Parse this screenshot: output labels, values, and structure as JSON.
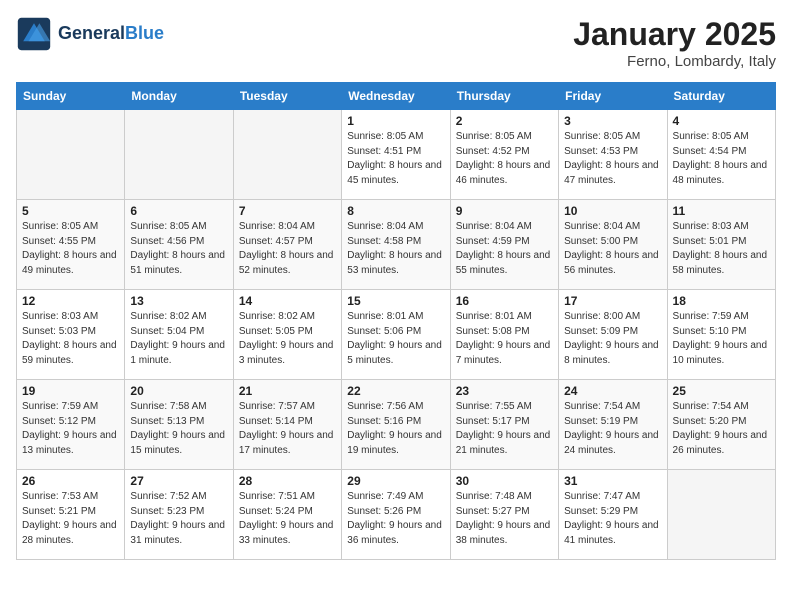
{
  "header": {
    "logo_line1": "General",
    "logo_line2": "Blue",
    "title": "January 2025",
    "subtitle": "Ferno, Lombardy, Italy"
  },
  "weekdays": [
    "Sunday",
    "Monday",
    "Tuesday",
    "Wednesday",
    "Thursday",
    "Friday",
    "Saturday"
  ],
  "weeks": [
    [
      {
        "day": "",
        "info": ""
      },
      {
        "day": "",
        "info": ""
      },
      {
        "day": "",
        "info": ""
      },
      {
        "day": "1",
        "info": "Sunrise: 8:05 AM\nSunset: 4:51 PM\nDaylight: 8 hours\nand 45 minutes."
      },
      {
        "day": "2",
        "info": "Sunrise: 8:05 AM\nSunset: 4:52 PM\nDaylight: 8 hours\nand 46 minutes."
      },
      {
        "day": "3",
        "info": "Sunrise: 8:05 AM\nSunset: 4:53 PM\nDaylight: 8 hours\nand 47 minutes."
      },
      {
        "day": "4",
        "info": "Sunrise: 8:05 AM\nSunset: 4:54 PM\nDaylight: 8 hours\nand 48 minutes."
      }
    ],
    [
      {
        "day": "5",
        "info": "Sunrise: 8:05 AM\nSunset: 4:55 PM\nDaylight: 8 hours\nand 49 minutes."
      },
      {
        "day": "6",
        "info": "Sunrise: 8:05 AM\nSunset: 4:56 PM\nDaylight: 8 hours\nand 51 minutes."
      },
      {
        "day": "7",
        "info": "Sunrise: 8:04 AM\nSunset: 4:57 PM\nDaylight: 8 hours\nand 52 minutes."
      },
      {
        "day": "8",
        "info": "Sunrise: 8:04 AM\nSunset: 4:58 PM\nDaylight: 8 hours\nand 53 minutes."
      },
      {
        "day": "9",
        "info": "Sunrise: 8:04 AM\nSunset: 4:59 PM\nDaylight: 8 hours\nand 55 minutes."
      },
      {
        "day": "10",
        "info": "Sunrise: 8:04 AM\nSunset: 5:00 PM\nDaylight: 8 hours\nand 56 minutes."
      },
      {
        "day": "11",
        "info": "Sunrise: 8:03 AM\nSunset: 5:01 PM\nDaylight: 8 hours\nand 58 minutes."
      }
    ],
    [
      {
        "day": "12",
        "info": "Sunrise: 8:03 AM\nSunset: 5:03 PM\nDaylight: 8 hours\nand 59 minutes."
      },
      {
        "day": "13",
        "info": "Sunrise: 8:02 AM\nSunset: 5:04 PM\nDaylight: 9 hours\nand 1 minute."
      },
      {
        "day": "14",
        "info": "Sunrise: 8:02 AM\nSunset: 5:05 PM\nDaylight: 9 hours\nand 3 minutes."
      },
      {
        "day": "15",
        "info": "Sunrise: 8:01 AM\nSunset: 5:06 PM\nDaylight: 9 hours\nand 5 minutes."
      },
      {
        "day": "16",
        "info": "Sunrise: 8:01 AM\nSunset: 5:08 PM\nDaylight: 9 hours\nand 7 minutes."
      },
      {
        "day": "17",
        "info": "Sunrise: 8:00 AM\nSunset: 5:09 PM\nDaylight: 9 hours\nand 8 minutes."
      },
      {
        "day": "18",
        "info": "Sunrise: 7:59 AM\nSunset: 5:10 PM\nDaylight: 9 hours\nand 10 minutes."
      }
    ],
    [
      {
        "day": "19",
        "info": "Sunrise: 7:59 AM\nSunset: 5:12 PM\nDaylight: 9 hours\nand 13 minutes."
      },
      {
        "day": "20",
        "info": "Sunrise: 7:58 AM\nSunset: 5:13 PM\nDaylight: 9 hours\nand 15 minutes."
      },
      {
        "day": "21",
        "info": "Sunrise: 7:57 AM\nSunset: 5:14 PM\nDaylight: 9 hours\nand 17 minutes."
      },
      {
        "day": "22",
        "info": "Sunrise: 7:56 AM\nSunset: 5:16 PM\nDaylight: 9 hours\nand 19 minutes."
      },
      {
        "day": "23",
        "info": "Sunrise: 7:55 AM\nSunset: 5:17 PM\nDaylight: 9 hours\nand 21 minutes."
      },
      {
        "day": "24",
        "info": "Sunrise: 7:54 AM\nSunset: 5:19 PM\nDaylight: 9 hours\nand 24 minutes."
      },
      {
        "day": "25",
        "info": "Sunrise: 7:54 AM\nSunset: 5:20 PM\nDaylight: 9 hours\nand 26 minutes."
      }
    ],
    [
      {
        "day": "26",
        "info": "Sunrise: 7:53 AM\nSunset: 5:21 PM\nDaylight: 9 hours\nand 28 minutes."
      },
      {
        "day": "27",
        "info": "Sunrise: 7:52 AM\nSunset: 5:23 PM\nDaylight: 9 hours\nand 31 minutes."
      },
      {
        "day": "28",
        "info": "Sunrise: 7:51 AM\nSunset: 5:24 PM\nDaylight: 9 hours\nand 33 minutes."
      },
      {
        "day": "29",
        "info": "Sunrise: 7:49 AM\nSunset: 5:26 PM\nDaylight: 9 hours\nand 36 minutes."
      },
      {
        "day": "30",
        "info": "Sunrise: 7:48 AM\nSunset: 5:27 PM\nDaylight: 9 hours\nand 38 minutes."
      },
      {
        "day": "31",
        "info": "Sunrise: 7:47 AM\nSunset: 5:29 PM\nDaylight: 9 hours\nand 41 minutes."
      },
      {
        "day": "",
        "info": ""
      }
    ]
  ]
}
